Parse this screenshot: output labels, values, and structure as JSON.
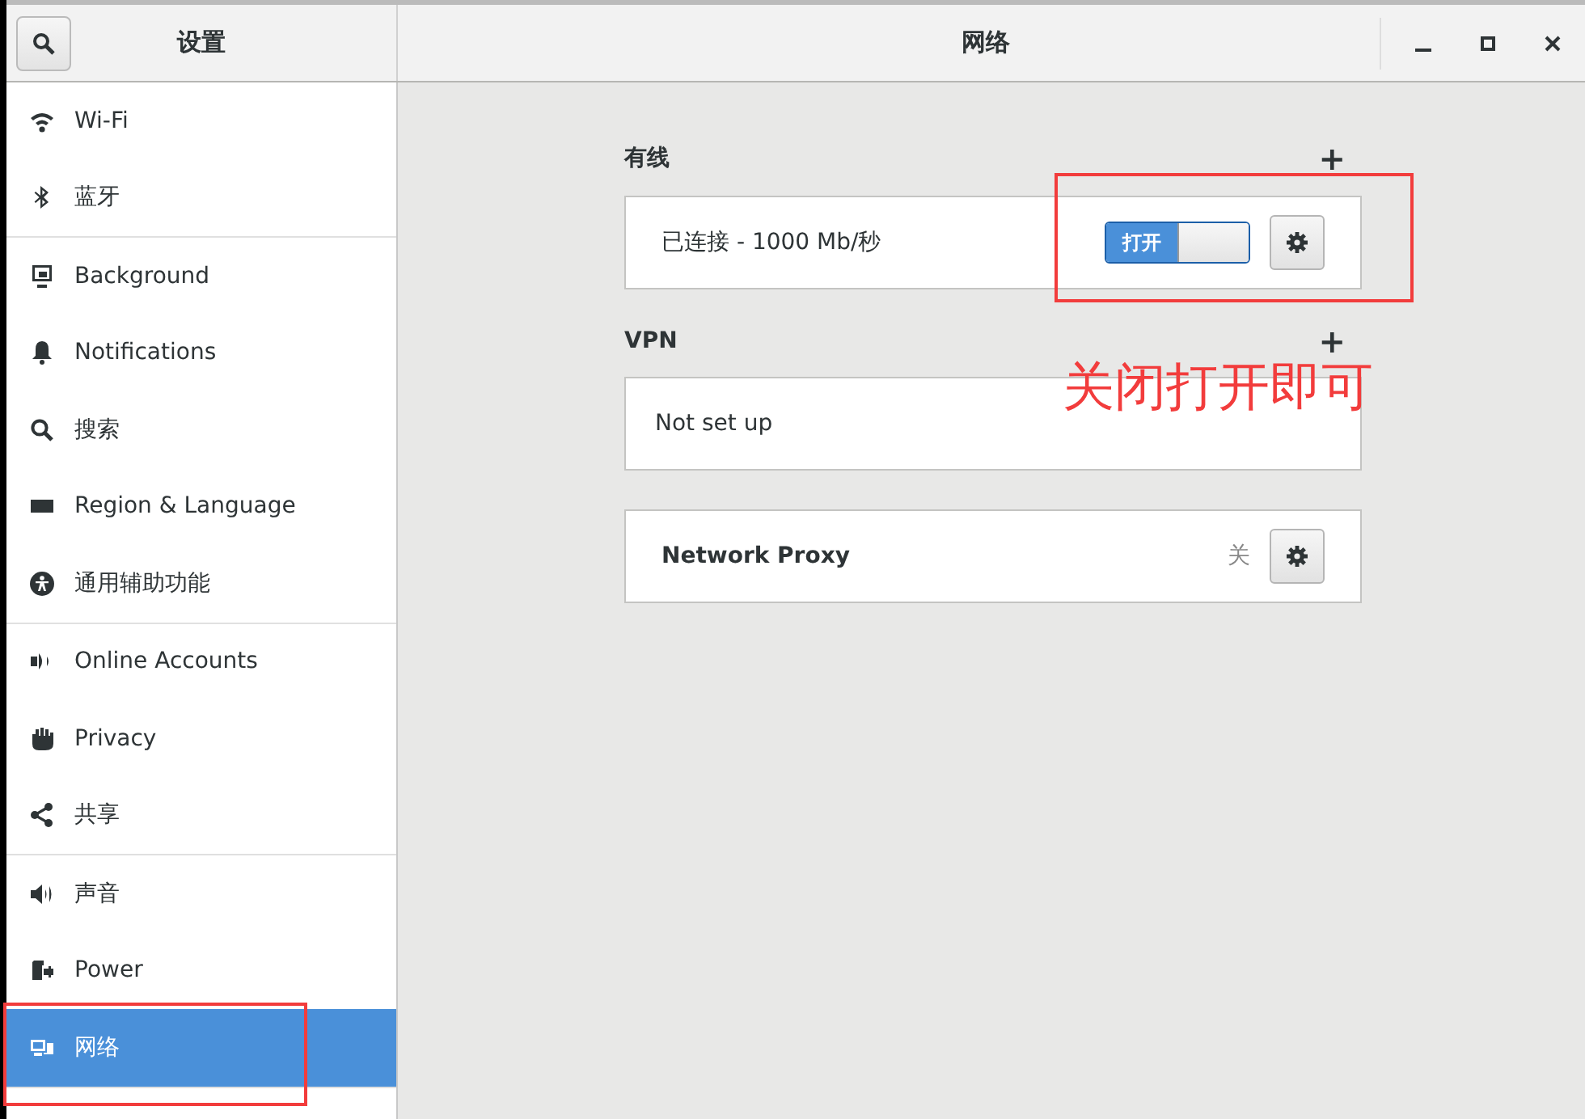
{
  "sidebar": {
    "title": "设置",
    "groups": [
      {
        "items": [
          {
            "label": "Wi-Fi",
            "selected": false
          },
          {
            "label": "蓝牙",
            "selected": false
          }
        ]
      },
      {
        "items": [
          {
            "label": "Background",
            "selected": false
          },
          {
            "label": "Notifications",
            "selected": false
          },
          {
            "label": "搜索",
            "selected": false
          },
          {
            "label": "Region & Language",
            "selected": false
          },
          {
            "label": "通用辅助功能",
            "selected": false
          }
        ]
      },
      {
        "items": [
          {
            "label": "Online Accounts",
            "selected": false
          },
          {
            "label": "Privacy",
            "selected": false
          },
          {
            "label": "共享",
            "selected": false
          }
        ]
      },
      {
        "items": [
          {
            "label": "声音",
            "selected": false
          },
          {
            "label": "Power",
            "selected": false
          },
          {
            "label": "网络",
            "selected": true
          }
        ]
      }
    ]
  },
  "window": {
    "title": "网络"
  },
  "sections": [
    {
      "heading": "有线",
      "add": "+",
      "rows": [
        {
          "kind": "switch",
          "label": "已连接 - 1000  Mb/秒",
          "switch": {
            "label": "打开",
            "on": true
          }
        }
      ]
    },
    {
      "heading": "VPN",
      "add": "+",
      "rows": [
        {
          "kind": "text",
          "label": "Not set up"
        }
      ]
    },
    {
      "rows": [
        {
          "kind": "status",
          "label": "Network Proxy",
          "status": "关"
        }
      ]
    }
  ],
  "annotation": {
    "note": "关闭打开即可"
  }
}
